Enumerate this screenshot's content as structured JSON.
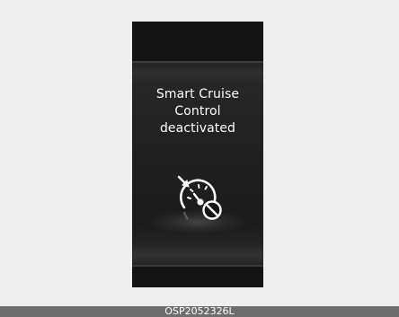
{
  "display": {
    "message_lines": [
      "Smart Cruise",
      "Control",
      "deactivated"
    ],
    "icon": "smart-cruise-control-off-icon"
  },
  "caption": {
    "code": "OSP2052326L"
  },
  "colors": {
    "panel": "#141414",
    "text": "#ffffff",
    "caption_bar": "#6d6d6d",
    "page": "#efefef"
  }
}
